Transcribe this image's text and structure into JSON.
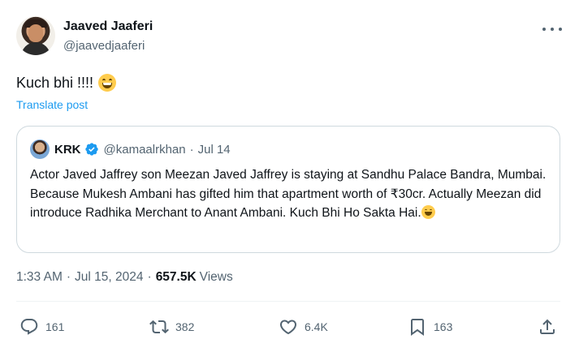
{
  "author": {
    "name": "Jaaved Jaaferi",
    "handle": "@jaavedjaaferi"
  },
  "tweet": {
    "text": "Kuch bhi !!!!",
    "emoji": "grinning-face-with-smiling-eyes",
    "translate_label": "Translate post"
  },
  "quoted": {
    "name": "KRK",
    "verified": true,
    "handle": "@kamaalrkhan",
    "separator": "·",
    "date": "Jul 14",
    "body": "Actor Javed Jaffrey son Meezan Javed Jaffrey is staying at Sandhu Palace Bandra, Mumbai. Because Mukesh Ambani has gifted him that apartment worth of ₹30cr. Actually Meezan did introduce Radhika Merchant to Anant Ambani. Kuch Bhi Ho Sakta Hai.",
    "emoji": "grinning-face-with-smiling-eyes"
  },
  "meta": {
    "time": "1:33 AM",
    "separator": "·",
    "date": "Jul 15, 2024",
    "views_count": "657.5K",
    "views_label": "Views"
  },
  "actions": {
    "replies": "161",
    "reposts": "382",
    "likes": "6.4K",
    "bookmarks": "163"
  },
  "icons": {
    "more": "more-icon",
    "verified": "verified-badge-icon",
    "reply": "reply-icon",
    "repost": "repost-icon",
    "like": "heart-icon",
    "bookmark": "bookmark-icon",
    "share": "share-icon"
  },
  "colors": {
    "text": "#0f1419",
    "secondary": "#536471",
    "accent": "#1d9bf0",
    "border": "#cfd9de"
  }
}
